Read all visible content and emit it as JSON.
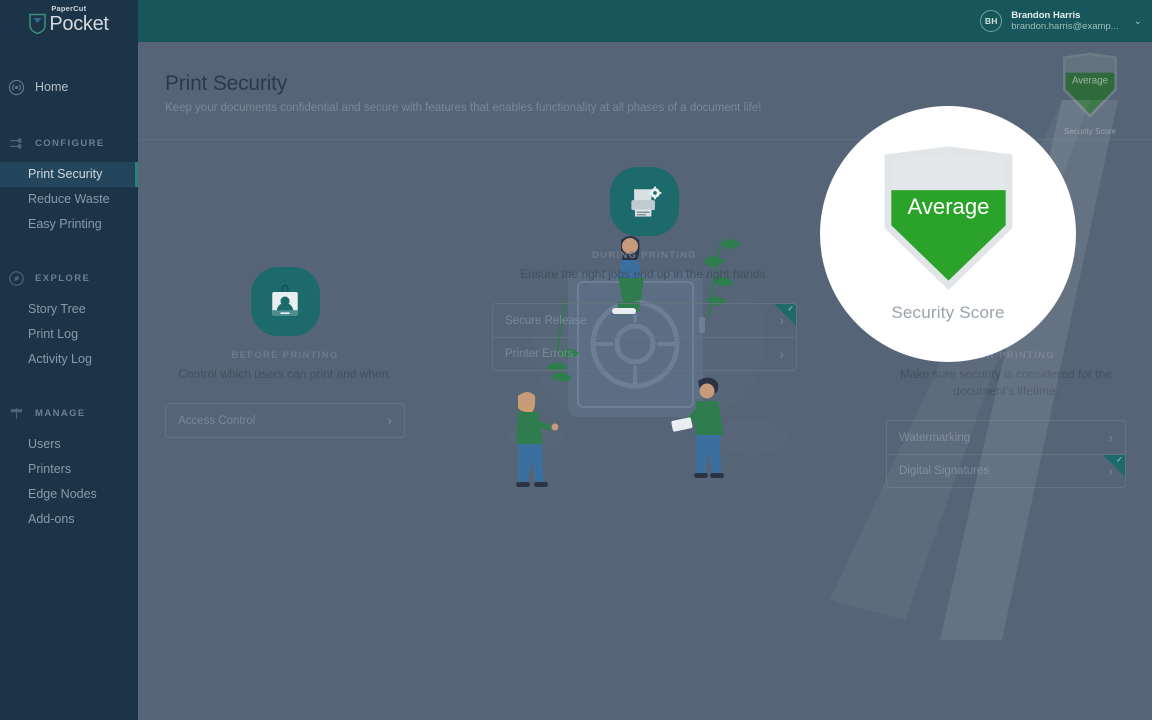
{
  "brand": {
    "sub": "PaperCut",
    "name": "Pocket",
    "shield_icon": "papercut-shield-icon"
  },
  "topbar": {
    "avatar_initials": "BH",
    "user_name": "Brandon Harris",
    "user_email": "brandon.harris@examp...",
    "caret_icon": "chevron-down-icon"
  },
  "sidebar": {
    "home": {
      "label": "Home",
      "icon": "home-radar-icon"
    },
    "groups": [
      {
        "title": "CONFIGURE",
        "icon": "sliders-icon",
        "items": [
          {
            "label": "Print Security",
            "active": true
          },
          {
            "label": "Reduce Waste",
            "active": false
          },
          {
            "label": "Easy Printing",
            "active": false
          }
        ]
      },
      {
        "title": "EXPLORE",
        "icon": "compass-icon",
        "items": [
          {
            "label": "Story Tree",
            "active": false
          },
          {
            "label": "Print Log",
            "active": false
          },
          {
            "label": "Activity Log",
            "active": false
          }
        ]
      },
      {
        "title": "MANAGE",
        "icon": "signpost-icon",
        "items": [
          {
            "label": "Users",
            "active": false
          },
          {
            "label": "Printers",
            "active": false
          },
          {
            "label": "Edge Nodes",
            "active": false
          },
          {
            "label": "Add-ons",
            "active": false
          }
        ]
      }
    ]
  },
  "page": {
    "title": "Print Security",
    "subtitle": "Keep your documents confidential and secure with features that enables functionality at all phases of a document life!"
  },
  "stages": {
    "before": {
      "icon": "id-badge-lock-icon",
      "label": "BEFORE PRINTING",
      "description": "Control which users can print and when.",
      "options": [
        {
          "label": "Access Control",
          "completed": false,
          "chevron": "chevron-right-icon"
        }
      ]
    },
    "during": {
      "icon": "printer-settings-icon",
      "label": "DURING PRINTING",
      "description": "Ensure the right jobs end up in the right hands.",
      "options": [
        {
          "label": "Secure Release",
          "completed": true,
          "chevron": "chevron-right-icon"
        },
        {
          "label": "Printer Errors",
          "completed": false,
          "chevron": "chevron-right-icon"
        }
      ]
    },
    "after": {
      "label": "AFTER PRINTING",
      "description": "Make sure security is considered for the document's lifetime.",
      "options": [
        {
          "label": "Watermarking",
          "completed": false,
          "chevron": "chevron-right-icon"
        },
        {
          "label": "Digital Signatures",
          "completed": true,
          "chevron": "chevron-right-icon"
        }
      ]
    }
  },
  "security_score": {
    "shield_icon": "security-score-shield-icon",
    "rating": "Average",
    "label": "Security Score",
    "fill_percent": 70,
    "fill_color": "#2ba32b",
    "empty_color": "#e4e7ea"
  },
  "colors": {
    "sidebar": "#1b3448",
    "topbar": "#17565a",
    "accent_teal": "#1d6a6c",
    "page_dim": "#556476",
    "green": "#2ba32b"
  }
}
